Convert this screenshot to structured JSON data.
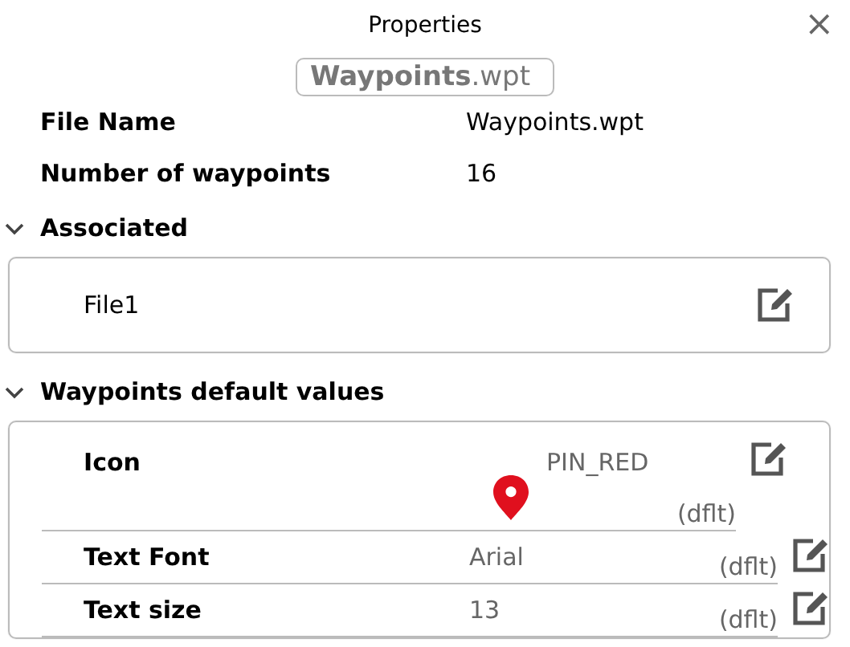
{
  "window": {
    "title": "Properties",
    "close": "×"
  },
  "file_chip": "**Waypoints**.wpt",
  "properties": [
    {
      "label": "File Name",
      "value": "Waypoints.wpt"
    },
    {
      "label": "Number of waypoints",
      "value": "16"
    }
  ],
  "sections": [
    {
      "title": "Associated",
      "expanded": true,
      "kind": "files",
      "items": [
        {
          "label": "File1"
        }
      ]
    },
    {
      "title": "Waypoints default values",
      "expanded": true,
      "kind": "defaults",
      "items": [
        {
          "kind": "icon",
          "label": "Icon",
          "value": "PIN_RED",
          "note": "(dflt)"
        },
        {
          "kind": "text",
          "label": "Text Font",
          "value": "Arial",
          "note": "(dflt)"
        },
        {
          "kind": "text",
          "label": "Text size",
          "value": "13",
          "note": "(dflt)"
        }
      ]
    }
  ]
}
